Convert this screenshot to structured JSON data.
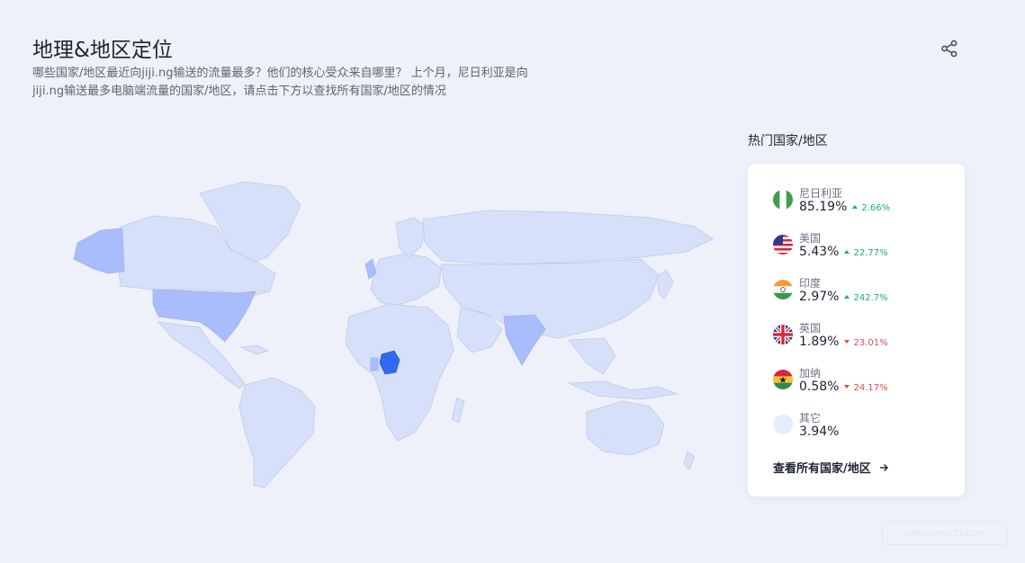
{
  "header": {
    "title": "地理&地区定位",
    "description": "哪些国家/地区最近向jiji.ng输送的流量最多？他们的核心受众来自哪里？ 上个月，尼日利亚是向jiji.ng输送最多电脑端流量的国家/地区，请点击下方以查找所有国家/地区的情况"
  },
  "icons": {
    "share": "share-icon",
    "view_all_arrow": "arrow-right-icon"
  },
  "map": {
    "colors": {
      "base": "#d6e0fa",
      "highlight_low": "#a9bcfb",
      "highlight_high": "#2f6bf0",
      "border": "#bcc7e2"
    }
  },
  "top_countries": {
    "heading": "热门国家/地区",
    "items": [
      {
        "name": "尼日利亚",
        "share": "85.19%",
        "change": "2.66%",
        "direction": "up",
        "flag": "nigeria-flag-icon"
      },
      {
        "name": "美国",
        "share": "5.43%",
        "change": "22.77%",
        "direction": "up",
        "flag": "usa-flag-icon"
      },
      {
        "name": "印度",
        "share": "2.97%",
        "change": "242.7%",
        "direction": "up",
        "flag": "india-flag-icon"
      },
      {
        "name": "英国",
        "share": "1.89%",
        "change": "23.01%",
        "direction": "down",
        "flag": "uk-flag-icon"
      },
      {
        "name": "加纳",
        "share": "0.58%",
        "change": "24.17%",
        "direction": "down",
        "flag": "ghana-flag-icon"
      },
      {
        "name": "其它",
        "share": "3.94%",
        "change": "",
        "direction": "",
        "flag": "other-placeholder-icon"
      }
    ],
    "view_all": "查看所有国家/地区"
  },
  "colors": {
    "up": "#15b36c",
    "down": "#e5484d",
    "accent": "#2f6bf0"
  },
  "watermark": "www.sem123.com"
}
